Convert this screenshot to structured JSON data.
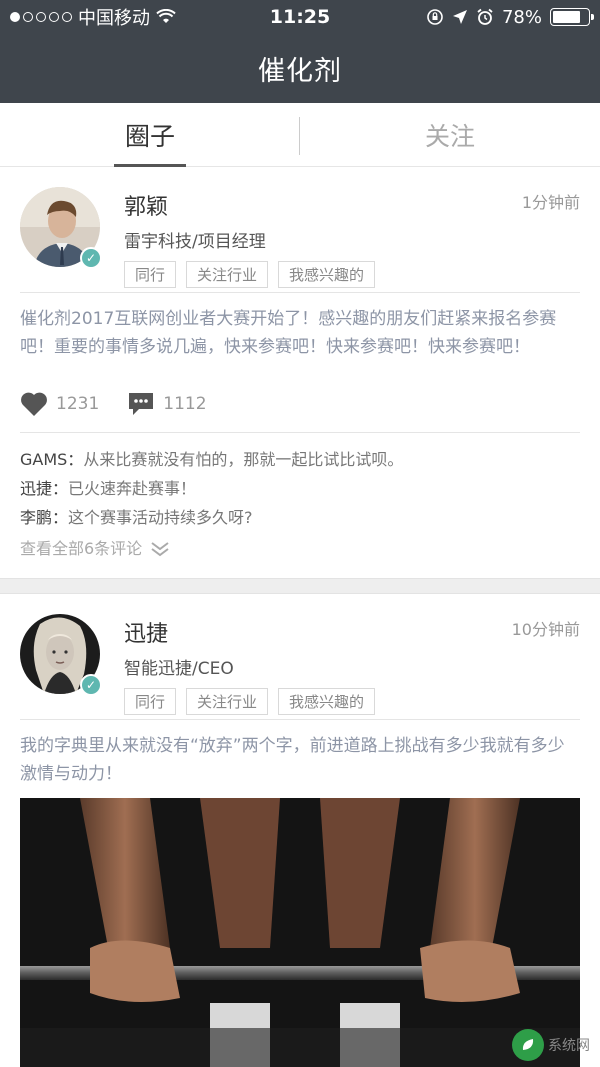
{
  "status_bar": {
    "carrier": "中国移动",
    "time": "11:25",
    "battery": "78%",
    "battery_level": 0.78
  },
  "nav": {
    "title": "催化剂"
  },
  "tabs": [
    {
      "label": "圈子",
      "active": true
    },
    {
      "label": "关注",
      "active": false
    }
  ],
  "posts": [
    {
      "name": "郭颖",
      "title": "雷宇科技/项目经理",
      "time": "1分钟前",
      "tags": [
        "同行",
        "关注行业",
        "我感兴趣的"
      ],
      "content": "催化剂2017互联网创业者大赛开始了！感兴趣的朋友们赶紧来报名参赛吧！重要的事情多说几遍，快来参赛吧！快来参赛吧！快来参赛吧！",
      "likes": "1231",
      "comment_count": "1112",
      "comments": [
        {
          "user": "GAMS：",
          "text": "从来比赛就没有怕的，那就一起比试比试呗。"
        },
        {
          "user": "迅捷：",
          "text": "已火速奔赴赛事！"
        },
        {
          "user": "李鹏：",
          "text": "这个赛事活动持续多久呀?"
        }
      ],
      "view_all": "查看全部6条评论"
    },
    {
      "name": "迅捷",
      "title": "智能迅捷/CEO",
      "time": "10分钟前",
      "tags": [
        "同行",
        "关注行业",
        "我感兴趣的"
      ],
      "content": "我的字典里从来就没有“放弃”两个字，前进道路上挑战有多少我就有多少激情与动力！"
    }
  ],
  "colors": {
    "topbar": "#3f454c",
    "verified": "#5fb7b0",
    "content_text": "#8d95a6"
  },
  "watermark": {
    "text": "系统网"
  }
}
